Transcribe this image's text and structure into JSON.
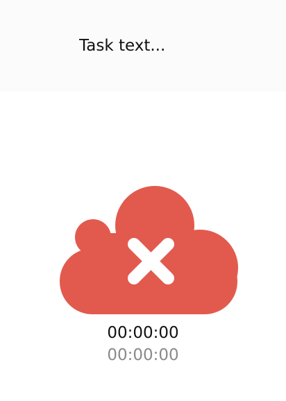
{
  "task": {
    "placeholder": "Task text...",
    "value": ""
  },
  "status": {
    "icon": "cloud-error-icon",
    "color": "#e25a4e"
  },
  "timers": {
    "current": "00:00:00",
    "total": "00:00:00"
  }
}
